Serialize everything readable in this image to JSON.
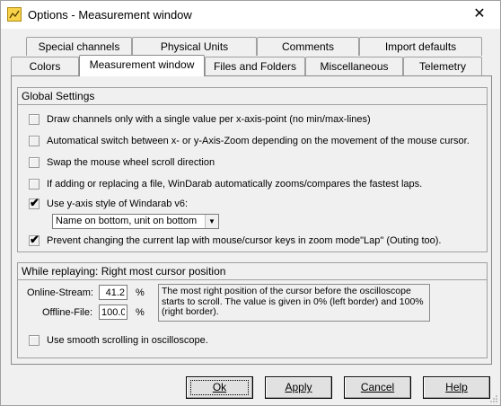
{
  "window": {
    "title": "Options - Measurement window",
    "close_glyph": "✕",
    "icon": "app-chart-icon"
  },
  "tabs": {
    "row_back": [
      {
        "label": "Special channels"
      },
      {
        "label": "Physical Units"
      },
      {
        "label": "Comments"
      },
      {
        "label": "Import defaults"
      }
    ],
    "row_front": [
      {
        "label": "Colors"
      },
      {
        "label": "Measurement window",
        "active": true
      },
      {
        "label": "Files and Folders"
      },
      {
        "label": "Miscellaneous"
      },
      {
        "label": "Telemetry"
      }
    ]
  },
  "global": {
    "title": "Global Settings",
    "options": [
      {
        "label": "Draw channels only with a single value per x-axis-point (no min/max-lines)",
        "checked": false
      },
      {
        "label": "Automatical switch between x- or y-Axis-Zoom depending on the movement of the mouse cursor.",
        "checked": false
      },
      {
        "label": "Swap the mouse wheel scroll direction",
        "checked": false
      },
      {
        "label": "If adding or replacing a file, WinDarab automatically zooms/compares the fastest laps.",
        "checked": false
      },
      {
        "label": "Use y-axis style of Windarab v6:",
        "checked": true
      },
      {
        "label": "Prevent changing the current lap with mouse/cursor keys in zoom mode\"Lap\" (Outing too).",
        "checked": true
      }
    ],
    "yaxis_style": {
      "selected": "Name on bottom, unit on bottom"
    },
    "check_glyph": "✔"
  },
  "replay": {
    "title": "While replaying: Right most cursor position",
    "online_label": "Online-Stream:",
    "online_value": "41.2",
    "offline_label": "Offline-File:",
    "offline_value": "100.0",
    "unit": "%",
    "info": "The most right position of the cursor before the oscilloscope starts to scroll. The value is given in 0% (left border) and 100% (right border).",
    "smooth_label": "Use smooth scrolling in oscilloscope.",
    "smooth_checked": false
  },
  "buttons": {
    "ok": "Ok",
    "apply": "Apply",
    "cancel": "Cancel",
    "help": "Help"
  }
}
